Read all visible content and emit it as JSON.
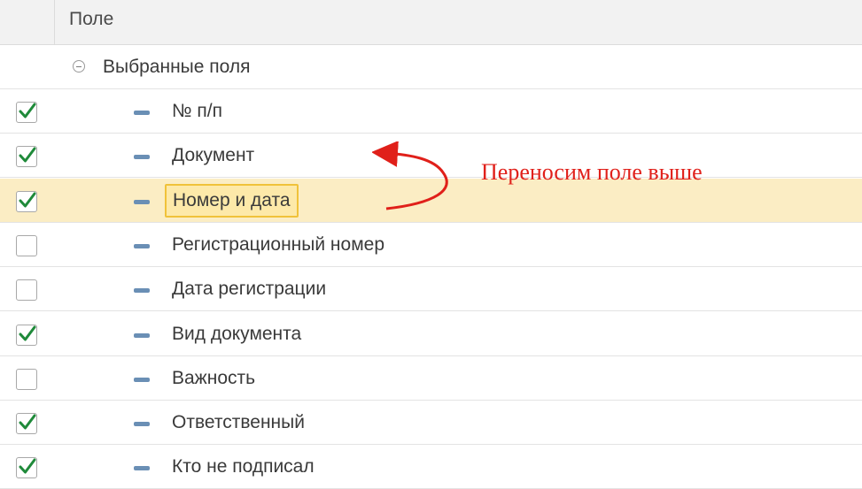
{
  "header": {
    "title": "Поле"
  },
  "group": {
    "label": "Выбранные поля",
    "expanded": true
  },
  "fields": [
    {
      "label": "№ п/п",
      "checked": true
    },
    {
      "label": "Документ",
      "checked": true
    },
    {
      "label": "Номер и дата",
      "checked": true,
      "selected": true
    },
    {
      "label": "Регистрационный номер",
      "checked": false
    },
    {
      "label": "Дата регистрации",
      "checked": false
    },
    {
      "label": "Вид документа",
      "checked": true
    },
    {
      "label": "Важность",
      "checked": false
    },
    {
      "label": "Ответственный",
      "checked": true
    },
    {
      "label": "Кто не подписал",
      "checked": true
    }
  ],
  "annotation": {
    "text": "Переносим поле выше",
    "color": "#e0201a"
  },
  "colors": {
    "check": "#1f8a3a",
    "selected_row": "#fbedc4",
    "focus_border": "#f0c23a",
    "field_icon": "#6a8fb5"
  }
}
